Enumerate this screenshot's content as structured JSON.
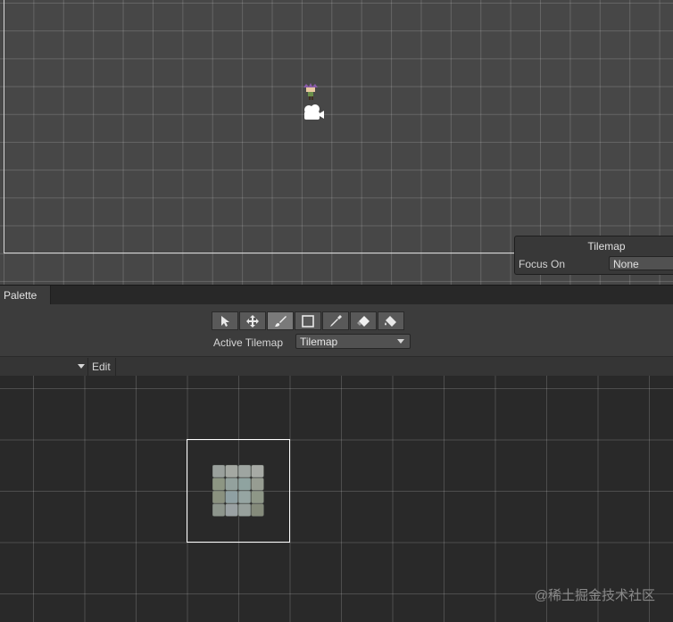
{
  "scene": {
    "overlay": {
      "title": "Tilemap",
      "focus_label": "Focus On",
      "focus_value": "None"
    }
  },
  "palette": {
    "tab_label": "Palette",
    "tools": [
      {
        "icon": "select-arrow-icon",
        "active": false
      },
      {
        "icon": "move-icon",
        "active": false
      },
      {
        "icon": "paintbrush-icon",
        "active": true
      },
      {
        "icon": "box-fill-icon",
        "active": false
      },
      {
        "icon": "picker-icon",
        "active": false
      },
      {
        "icon": "eraser-icon",
        "active": false
      },
      {
        "icon": "fill-bucket-icon",
        "active": false
      }
    ],
    "active_tilemap_label": "Active Tilemap",
    "active_tilemap_value": "Tilemap",
    "edit_label": "Edit"
  },
  "watermark": "@稀土掘金技术社区",
  "colors": {
    "scene_bg": "#474747",
    "palette_bg": "#292929",
    "toolbar_bg": "#3c3c3c",
    "active_tool": "#7a7a7a"
  }
}
